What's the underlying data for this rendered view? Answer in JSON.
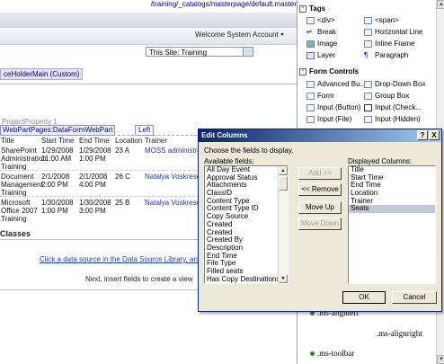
{
  "page": {
    "url": "/training/_catalogs/masterpage/default.master",
    "welcome": "Welcome System Account",
    "site_select": "This Site: Training",
    "placeholder_tag": "ceHolderMain (Custom)",
    "project_text": "ProjectProperty 1",
    "webpart_tag": "WebPartPages:DataFormWebPart",
    "left_tag": "Left",
    "table": {
      "headers": [
        "Title",
        "Start Time",
        "End Time",
        "Location",
        "Trainer"
      ],
      "rows": [
        {
          "title": [
            "SharePoint",
            "Administration",
            "Training"
          ],
          "start": [
            "1/29/2008",
            "11:00 AM"
          ],
          "end": [
            "1/29/2008",
            "1:00 PM"
          ],
          "location": "23 A",
          "trainer": "MOSS administrato"
        },
        {
          "title": [
            "Document",
            "Management",
            "Training"
          ],
          "start": [
            "2/1/2008",
            "2:00 PM"
          ],
          "end": [
            "2/1/2008",
            "4:00 PM"
          ],
          "location": "26 C",
          "trainer": "Natalya Voskresens"
        },
        {
          "title": [
            "Microsoft",
            "Office 2007",
            "Training"
          ],
          "start": [
            "1/30/2008",
            "1:00 PM"
          ],
          "end": [
            "1/30/2008",
            "3:00 PM"
          ],
          "location": "25 B",
          "trainer": "Natalya Voskresens"
        }
      ]
    },
    "classes_heading": "Classes",
    "datasource_link": "Click a data source in the Data Source Library, and then",
    "next_text": "Next, insert fields to create a view"
  },
  "toolbox": {
    "tags_heading": "Tags",
    "tags": [
      {
        "label": "<div>",
        "icon": "div-tag-icon"
      },
      {
        "label": "<span>",
        "icon": "span-tag-icon"
      },
      {
        "label": "Break",
        "icon": "break-icon"
      },
      {
        "label": "Horizontal Line",
        "icon": "horizontal-line-icon"
      },
      {
        "label": "Image",
        "icon": "image-icon"
      },
      {
        "label": "Inline Frame",
        "icon": "inline-frame-icon"
      },
      {
        "label": "Layer",
        "icon": "layer-icon"
      },
      {
        "label": "Paragraph",
        "icon": "paragraph-icon"
      }
    ],
    "forms_heading": "Form Controls",
    "forms": [
      {
        "label": "Advanced Bu...",
        "icon": "advanced-button-icon"
      },
      {
        "label": "Drop-Down Box",
        "icon": "dropdown-box-icon"
      },
      {
        "label": "Form",
        "icon": "form-icon"
      },
      {
        "label": "Group Box",
        "icon": "group-box-icon"
      },
      {
        "label": "Input (Button)",
        "icon": "input-button-icon"
      },
      {
        "label": "Input (Check...",
        "icon": "input-checkbox-icon"
      },
      {
        "label": "Input (File)",
        "icon": "input-file-icon"
      },
      {
        "label": "Input (Hidden)",
        "icon": "input-hidden-icon"
      }
    ],
    "css_items": [
      ".ms-alignleft",
      ".ms-alignright",
      ".ms-toolbar"
    ]
  },
  "dialog": {
    "title": "Edit Columns",
    "help": "?",
    "close": "X",
    "instruction": "Choose the fields to display.",
    "available_label": "Available fields:",
    "displayed_label": "Displayed Columns:",
    "available_fields": [
      "All Day Event",
      "Approval Status",
      "Attachments",
      "ClassID",
      "Content Type",
      "Content Type ID",
      "Copy Source",
      "Created",
      "Created",
      "Created By",
      "Description",
      "End Time",
      "File Type",
      "Filled seats",
      "Has Copy Destinations"
    ],
    "displayed_columns": [
      "Title",
      "Start Time",
      "End Time",
      "Location",
      "Trainer",
      "Seats"
    ],
    "selected_column": "Seats",
    "buttons": {
      "add": "Add >>",
      "remove": "<< Remove",
      "move_up": "Move Up",
      "move_down": "Move Down",
      "ok": "OK",
      "cancel": "Cancel"
    }
  }
}
